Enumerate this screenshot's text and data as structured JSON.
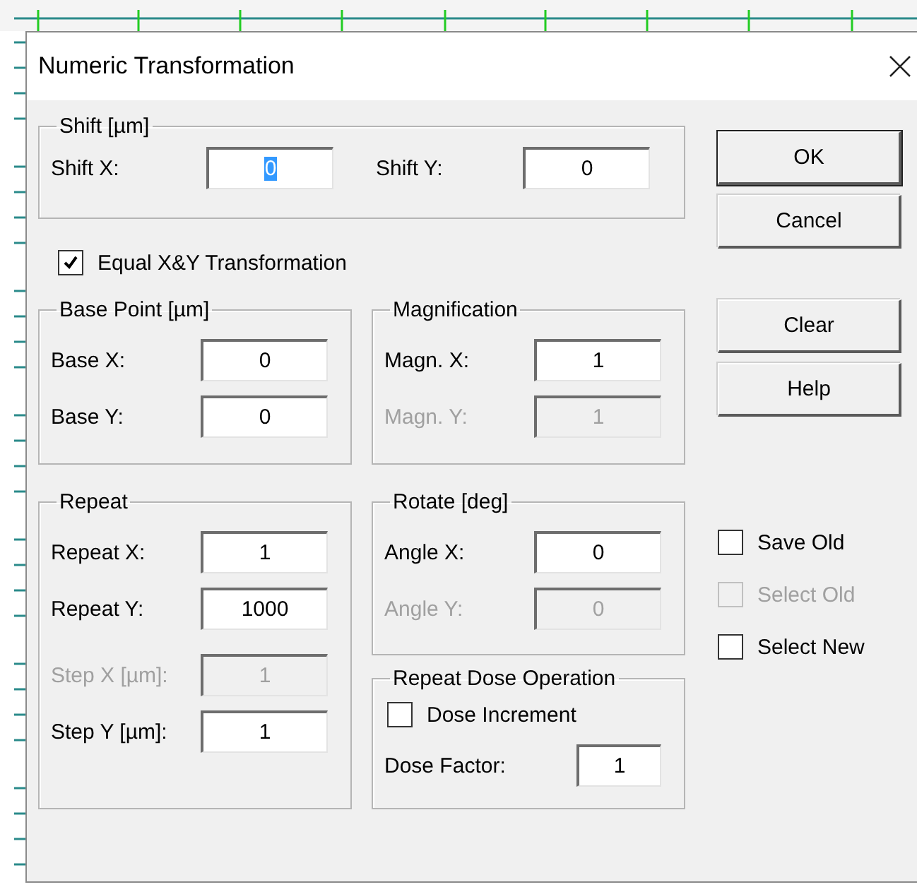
{
  "window": {
    "title": "Numeric Transformation"
  },
  "groups": [
    {
      "title": "Shift [µm]",
      "items": [
        {
          "kind": "field",
          "label": "Shift X:",
          "value": "0",
          "disabled": false,
          "text_selected": true
        },
        {
          "kind": "field",
          "label": "Shift Y:",
          "value": "0",
          "disabled": false,
          "text_selected": false
        }
      ]
    },
    {
      "title": "Base Point [µm]",
      "items": [
        {
          "kind": "field",
          "label": "Base X:",
          "value": "0",
          "disabled": false,
          "text_selected": false
        },
        {
          "kind": "field",
          "label": "Base Y:",
          "value": "0",
          "disabled": false,
          "text_selected": false
        }
      ]
    },
    {
      "title": "Magnification",
      "items": [
        {
          "kind": "field",
          "label": "Magn. X:",
          "value": "1",
          "disabled": false,
          "text_selected": false
        },
        {
          "kind": "field",
          "label": "Magn. Y:",
          "value": "1",
          "disabled": true,
          "text_selected": false
        }
      ]
    },
    {
      "title": "Repeat",
      "items": [
        {
          "kind": "field",
          "label": "Repeat X:",
          "value": "1",
          "disabled": false,
          "text_selected": false
        },
        {
          "kind": "field",
          "label": "Repeat Y:",
          "value": "1000",
          "disabled": false,
          "text_selected": false
        },
        {
          "kind": "field",
          "label": "Step X [µm]:",
          "value": "1",
          "disabled": true,
          "text_selected": false
        },
        {
          "kind": "field",
          "label": "Step Y [µm]:",
          "value": "1",
          "disabled": false,
          "text_selected": false
        }
      ]
    },
    {
      "title": "Rotate [deg]",
      "items": [
        {
          "kind": "field",
          "label": "Angle X:",
          "value": "0",
          "disabled": false,
          "text_selected": false
        },
        {
          "kind": "field",
          "label": "Angle Y:",
          "value": "0",
          "disabled": true,
          "text_selected": false
        }
      ]
    },
    {
      "title": "Repeat Dose Operation",
      "items": [
        {
          "kind": "checkbox",
          "label": "Dose Increment",
          "checked": false,
          "disabled": false
        },
        {
          "kind": "field",
          "label": "Dose Factor:",
          "value": "1",
          "disabled": false,
          "text_selected": false
        }
      ]
    }
  ],
  "equal_xy": {
    "label": "Equal X&Y Transformation",
    "checked": true,
    "disabled": false
  },
  "buttons": [
    {
      "label": "OK",
      "default": true
    },
    {
      "label": "Cancel",
      "default": false
    },
    {
      "label": "Clear",
      "default": false
    },
    {
      "label": "Help",
      "default": false
    }
  ],
  "options": [
    {
      "label": "Save Old",
      "checked": false,
      "disabled": false
    },
    {
      "label": "Select Old",
      "checked": false,
      "disabled": true
    },
    {
      "label": "Select New",
      "checked": false,
      "disabled": false
    }
  ]
}
